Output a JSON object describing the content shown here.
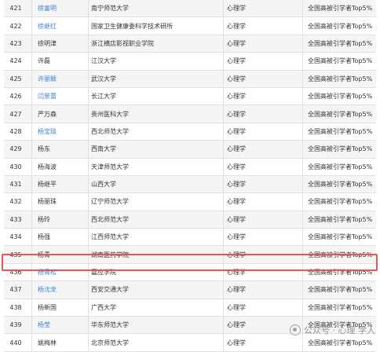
{
  "rows": [
    {
      "no": "421",
      "name": "徐富明",
      "org": "南宁师范大学",
      "field": "心理学",
      "honor": "全国高被引学者Top5%",
      "link": true
    },
    {
      "no": "422",
      "name": "徐继红",
      "org": "国家卫生健康委科学技术研所",
      "field": "心理学",
      "honor": "全国高被引学者Top5%",
      "link": true
    },
    {
      "no": "423",
      "name": "徐明津",
      "org": "浙江横店影视职业学院",
      "field": "心理学",
      "honor": "全国高被引学者Top5%",
      "link": false
    },
    {
      "no": "424",
      "name": "许磊",
      "org": "江汉大学",
      "field": "心理学",
      "honor": "全国高被引学者Top5%",
      "link": false
    },
    {
      "no": "425",
      "name": "许丽颖",
      "org": "武汉大学",
      "field": "心理学",
      "honor": "全国高被引学者Top5%",
      "link": true
    },
    {
      "no": "426",
      "name": "闫景蕾",
      "org": "长江大学",
      "field": "心理学",
      "honor": "全国高被引学者Top5%",
      "link": true
    },
    {
      "no": "427",
      "name": "严万森",
      "org": "贵州医科大学",
      "field": "心理学",
      "honor": "全国高被引学者Top5%",
      "link": false
    },
    {
      "no": "428",
      "name": "杨宝琰",
      "org": "西北师范大学",
      "field": "心理学",
      "honor": "全国高被引学者Top5%",
      "link": true
    },
    {
      "no": "429",
      "name": "杨东",
      "org": "西南大学",
      "field": "心理学",
      "honor": "全国高被引学者Top5%",
      "link": false
    },
    {
      "no": "430",
      "name": "杨海波",
      "org": "天津师范大学",
      "field": "心理学",
      "honor": "全国高被引学者Top5%",
      "link": false
    },
    {
      "no": "431",
      "name": "杨继平",
      "org": "山西大学",
      "field": "心理学",
      "honor": "全国高被引学者Top5%",
      "link": false
    },
    {
      "no": "432",
      "name": "杨丽珠",
      "org": "辽宁师范大学",
      "field": "心理学",
      "honor": "全国高被引学者Top5%",
      "link": false
    },
    {
      "no": "433",
      "name": "杨玲",
      "org": "西北师范大学",
      "field": "心理学",
      "honor": "全国高被引学者Top5%",
      "link": false
    },
    {
      "no": "434",
      "name": "杨强",
      "org": "江西师范大学",
      "field": "心理学",
      "honor": "全国高被引学者Top5%",
      "link": false
    },
    {
      "no": "435",
      "name": "杨青",
      "org": "湖南医药学院",
      "field": "心理学",
      "honor": "全国高被引学者Top5%",
      "link": false
    },
    {
      "no": "436",
      "name": "杨青松",
      "org": "嘉应学院",
      "field": "心理学",
      "honor": "全国高被引学者Top5%",
      "link": true
    },
    {
      "no": "437",
      "name": "杨沈龙",
      "org": "西安交通大学",
      "field": "心理学",
      "honor": "全国高被引学者Top5%",
      "link": true
    },
    {
      "no": "438",
      "name": "杨新国",
      "org": "广西大学",
      "field": "心理学",
      "honor": "全国高被引学者Top5%",
      "link": false
    },
    {
      "no": "439",
      "name": "杨莹",
      "org": "华东师范大学",
      "field": "心理学",
      "honor": "全国高被引学者Top5%",
      "link": true
    },
    {
      "no": "440",
      "name": "姚梅林",
      "org": "北京师范大学",
      "field": "心理学",
      "honor": "全国高被引学者Top5%",
      "link": false
    }
  ],
  "highlight_row": "436",
  "watermark": {
    "text": "公众号 · 心理 学人",
    "icon": "wechat-official-account-icon"
  },
  "colors": {
    "link": "#3f80cf",
    "highlight_border": "#e85555",
    "stripe": "#f5f5f5"
  }
}
